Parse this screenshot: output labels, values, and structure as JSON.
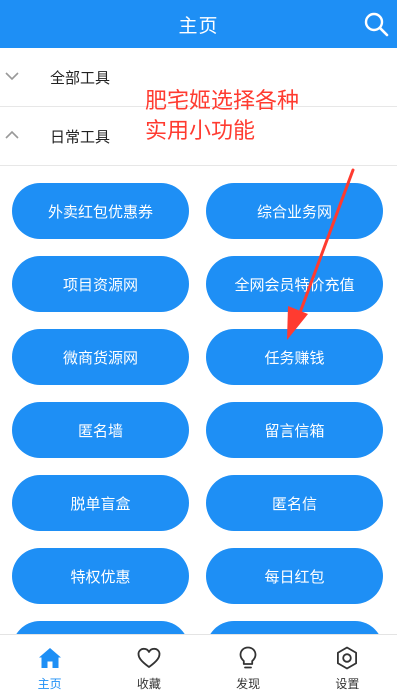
{
  "header": {
    "title": "主页",
    "search_icon": "search-icon"
  },
  "sections": [
    {
      "label": "全部工具",
      "state": "collapsed"
    },
    {
      "label": "日常工具",
      "state": "expanded"
    }
  ],
  "tools": [
    "外卖红包优惠券",
    "综合业务网",
    "项目资源网",
    "全网会员特价充值",
    "微商货源网",
    "任务赚钱",
    "匿名墙",
    "留言信箱",
    "脱单盲盒",
    "匿名信",
    "特权优惠",
    "每日红包",
    "",
    ""
  ],
  "annotation": {
    "line1": "肥宅姬选择各种",
    "line2": "实用小功能",
    "color": "#ff3b30"
  },
  "tabbar": [
    {
      "label": "主页",
      "icon": "home-icon",
      "active": true
    },
    {
      "label": "收藏",
      "icon": "heart-icon",
      "active": false
    },
    {
      "label": "发现",
      "icon": "bulb-icon",
      "active": false
    },
    {
      "label": "设置",
      "icon": "settings-icon",
      "active": false
    }
  ],
  "colors": {
    "primary": "#1e8ff5"
  }
}
